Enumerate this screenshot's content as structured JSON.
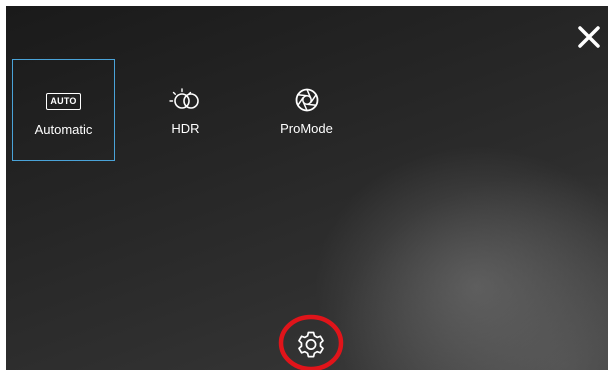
{
  "modes": [
    {
      "label": "Automatic",
      "icon": "auto-icon",
      "badge": "AUTO",
      "selected": true
    },
    {
      "label": "HDR",
      "icon": "hdr-icon",
      "selected": false
    },
    {
      "label": "ProMode",
      "icon": "aperture-icon",
      "selected": false
    }
  ],
  "icons": {
    "close": "close-icon",
    "settings": "gear-icon"
  },
  "colors": {
    "selection_border": "#4aa3d8",
    "settings_highlight_ring": "#e0141a",
    "text": "#ffffff"
  }
}
